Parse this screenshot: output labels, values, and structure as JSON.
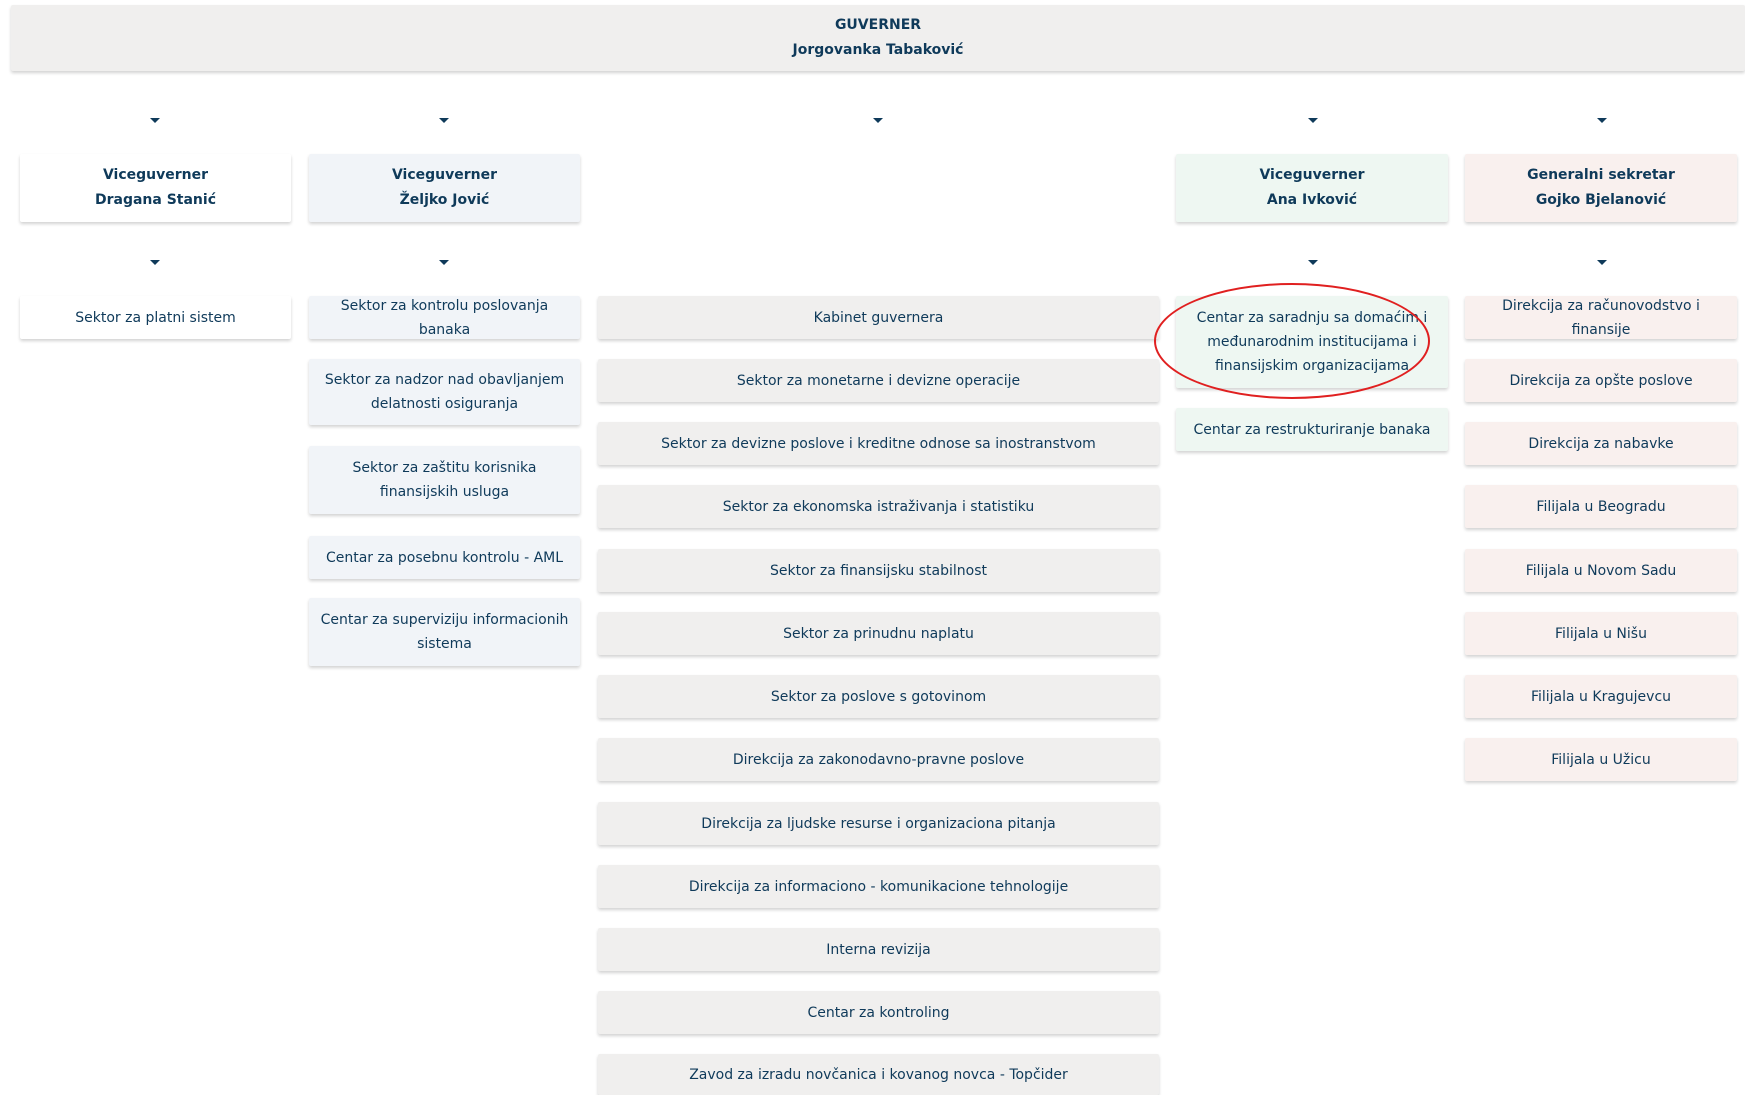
{
  "top": {
    "title": "GUVERNER",
    "name": "Jorgovanka Tabaković"
  },
  "col1": {
    "head": {
      "title": "Viceguverner",
      "name": "Dragana Stanić"
    },
    "items": [
      "Sektor za platni sistem"
    ]
  },
  "col2": {
    "head": {
      "title": "Viceguverner",
      "name": "Željko Jović"
    },
    "items": [
      "Sektor za kontrolu poslovanja banaka",
      "Sektor za nadzor nad obavljanjem delatnosti osiguranja",
      "Sektor za zaštitu korisnika finansijskih usluga",
      "Centar za posebnu kontrolu - AML",
      "Centar za superviziju informacionih sistema"
    ]
  },
  "col3": {
    "items": [
      "Kabinet guvernera",
      "Sektor za monetarne i devizne operacije",
      "Sektor za devizne poslove i kreditne odnose sa inostranstvom",
      "Sektor za ekonomska istraživanja i statistiku",
      "Sektor za finansijsku stabilnost",
      "Sektor za prinudnu naplatu",
      "Sektor za poslove s gotovinom",
      "Direkcija za zakonodavno-pravne poslove",
      "Direkcija za ljudske resurse i organizaciona pitanja",
      "Direkcija za informaciono - komunikacione tehnologije",
      "Interna revizija",
      "Centar za kontroling",
      "Zavod za izradu novčanica i kovanog novca - Topčider"
    ]
  },
  "col4": {
    "head": {
      "title": "Viceguverner",
      "name": "Ana Ivković"
    },
    "items": [
      "Centar za saradnju sa domaćim i međunarodnim institucijama i finansijskim organizacijama",
      "Centar za restrukturiranje banaka"
    ]
  },
  "col5": {
    "head": {
      "title": "Generalni sekretar",
      "name": "Gojko Bjelanović"
    },
    "items": [
      "Direkcija za računovodstvo i finansije",
      "Direkcija za opšte poslove",
      "Direkcija za nabavke",
      "Filijala u Beogradu",
      "Filijala u Novom Sadu",
      "Filijala u Nišu",
      "Filijala u Kragujevcu",
      "Filijala u Užicu"
    ]
  },
  "colors": {
    "highlight": "#e02020",
    "text": "#0f3a5a"
  }
}
